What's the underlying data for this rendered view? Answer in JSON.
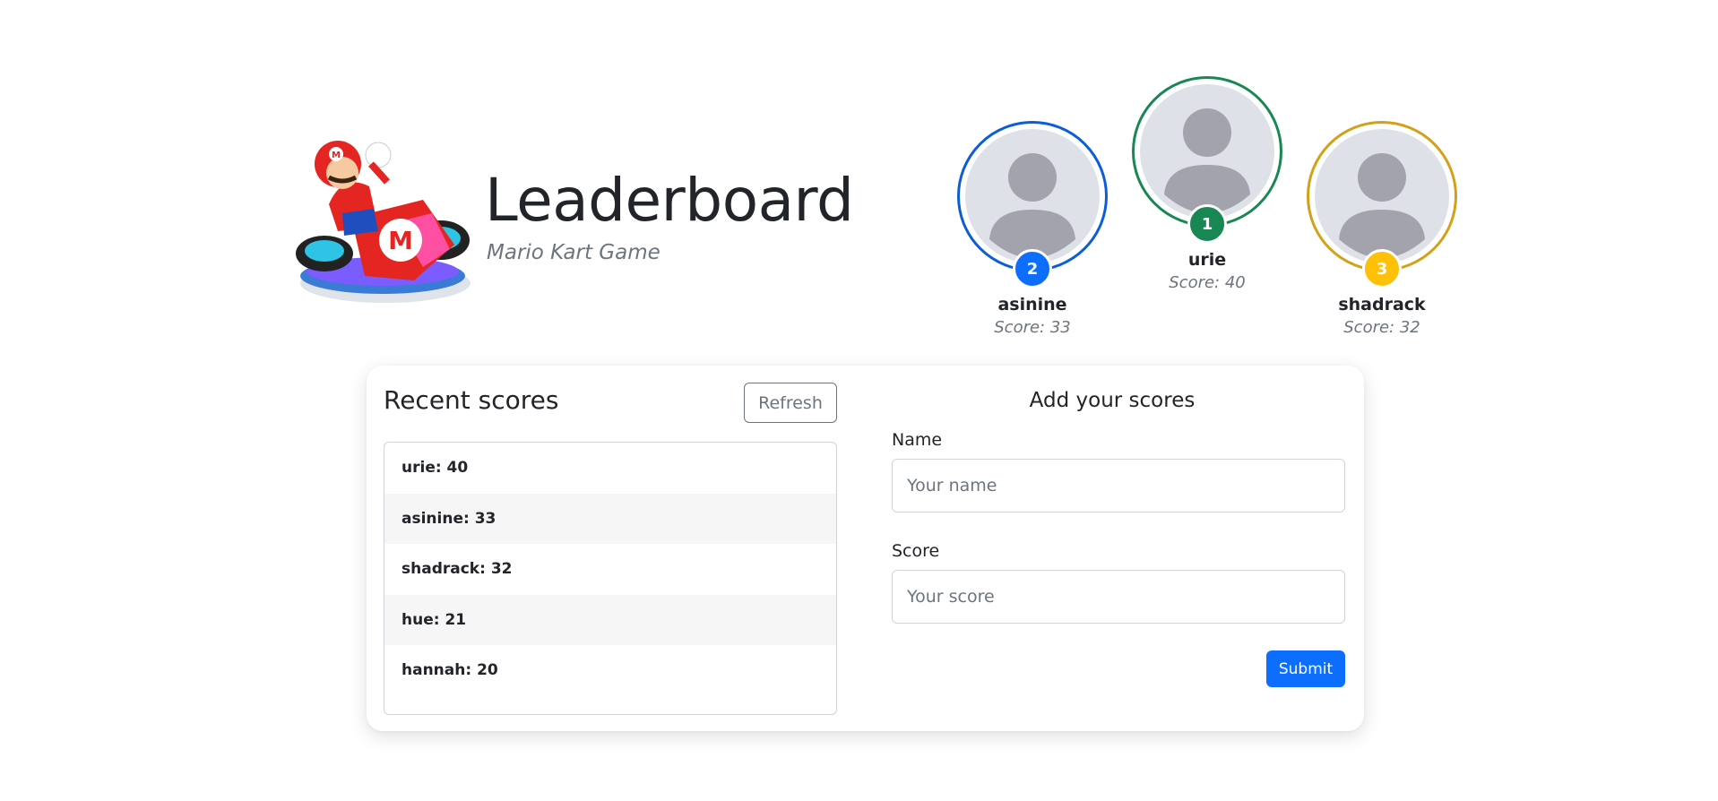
{
  "header": {
    "title": "Leaderboard",
    "subtitle": "Mario Kart Game",
    "mascot_icon": "kart-racer-illustration"
  },
  "podium": [
    {
      "rank": "2",
      "name": "asinine",
      "score": "Score: 33",
      "color": "#0d6efd",
      "ring": "#0b5ed7"
    },
    {
      "rank": "1",
      "name": "urie",
      "score": "Score: 40",
      "color": "#198754",
      "ring": "#198754"
    },
    {
      "rank": "3",
      "name": "shadrack",
      "score": "Score: 32",
      "color": "#ffc107",
      "ring": "#d4a017"
    }
  ],
  "recent": {
    "title": "Recent scores",
    "refresh_label": "Refresh",
    "items": [
      "urie: 40",
      "asinine: 33",
      "shadrack: 32",
      "hue: 21",
      "hannah: 20"
    ]
  },
  "form": {
    "title": "Add your scores",
    "name_label": "Name",
    "name_placeholder": "Your name",
    "score_label": "Score",
    "score_placeholder": "Your score",
    "submit_label": "Submit"
  },
  "colors": {
    "primary": "#0d6efd",
    "success": "#198754",
    "warning": "#ffc107",
    "muted": "#6c757d"
  }
}
